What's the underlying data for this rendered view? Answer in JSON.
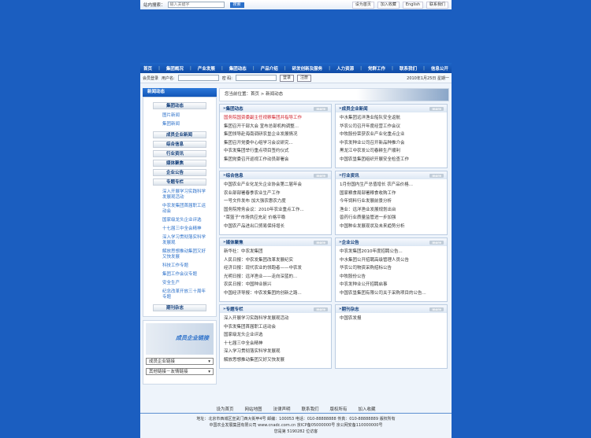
{
  "topbar": {
    "search_label": "站内搜索：",
    "search_placeholder": "输入关键字",
    "search_button": "搜索",
    "links": [
      "设为首页",
      "加入收藏",
      "English",
      "联系我们"
    ]
  },
  "nav": [
    "首页",
    "集团概况",
    "产业发展",
    "集团动态",
    "产品介绍",
    "研发创新及服务",
    "人力资源",
    "党群工作",
    "联系我们",
    "信息公开"
  ],
  "toolbar": {
    "login_label": "会员登录",
    "user_label": "用户名:",
    "pass_label": "密 码:",
    "login_button": "登录",
    "register_button": "注册",
    "date": "2010年1月25日 星期一"
  },
  "sidebar": {
    "title": "新闻动态",
    "items": [
      {
        "label": "集团动态",
        "subs": [
          "图片新闻",
          "集团新闻"
        ]
      },
      {
        "label": "成员企业新闻",
        "subs": []
      },
      {
        "label": "综合信息",
        "subs": []
      },
      {
        "label": "行业资讯",
        "subs": []
      },
      {
        "label": "媒体聚焦",
        "subs": []
      },
      {
        "label": "企业公告",
        "subs": []
      },
      {
        "label": "专题专栏",
        "subs": [
          "深入开展学习实践科学发展观活动",
          "中农发集团首届职工运动会",
          "国家级龙头企业评选",
          "十七届三中全会精神",
          "深入学习贯彻落实科学发展观",
          "解放思想推动集团又好又快发展",
          "科技工作专题",
          "集团工作会议专题",
          "安全生产",
          "纪念改革开放三十周年专题"
        ]
      },
      {
        "label": "期刊杂志",
        "subs": []
      }
    ],
    "banner_text": "成员企业链接",
    "select1": "成员企业链接",
    "select2": "其他链接－友情链接"
  },
  "breadcrumb": "您当前位置：首页 > 新闻动态",
  "panels": [
    {
      "title": "集团动态",
      "more": "more",
      "items": [
        "国务院国资委副主任视察集团并指导工作",
        "集团召开干部大会 宣布总部机构调整...",
        "集团领导赴海南调研农垦企业发展情况",
        "集团召开党委中心组学习会议研究...",
        "中农发集团举行重点项目签约仪式",
        "集团党委召开巡视工作动员部署会"
      ]
    },
    {
      "title": "成员企业新闻",
      "more": "more",
      "items": [
        "中水集团远洋渔业船队安全返航",
        "华农公司召开年度经营工作会议",
        "中牧股份荣获农业产业化重点企业",
        "中农发种业公司召开新品种推介会",
        "黑龙江中农发公司春耕生产顺利",
        "中国农垦集团组织开展安全检查工作"
      ]
    },
    {
      "title": "综合信息",
      "more": "more",
      "items": [
        "中国农业产业化龙头企业协会第二届年会",
        "农业部部署春季农业生产工作",
        "一号文件发布 加大强农惠农力度",
        "国务院常务会议：2010年农业重点工作...",
        "\"菜篮子\"市场供应充足 价格平稳",
        "中国农产品进出口贸易保持增长"
      ]
    },
    {
      "title": "行业资讯",
      "more": "more",
      "items": [
        "1月份国内生产总值增长 农产品价格...",
        "国家粮食局部署粮食收购工作",
        "今年饲料行业发展前景分析",
        "渔业：远洋渔业发展规划出台",
        "兽药行业质量监管进一步加强",
        "中国种业发展现状及未来趋势分析"
      ]
    },
    {
      "title": "媒体聚焦",
      "more": "more",
      "items": [
        "新华社：中农发集团",
        "人民日报：中农发集团改革发展纪实",
        "经济日报：现代农业的领跑者——中农发",
        "光明日报：远洋渔业——走向深蓝的...",
        "农民日报：中国种业振兴",
        "中国经济导报：中农发集团的创新之路..."
      ]
    },
    {
      "title": "企业公告",
      "more": "more",
      "items": [
        "中农发集团2010年度招聘公告...",
        "中水集团公开招聘高级管理人员公告",
        "华农公司物资采购招标公告",
        "中牧股份公告",
        "中农发种业公开招聘启事",
        "中国农垦集团有限公司关于采购项目的公告..."
      ]
    },
    {
      "title": "专题专栏",
      "more": "more",
      "items": [
        "深入开展学习实践科学发展观活动",
        "中农发集团首届职工运动会",
        "国家级龙头企业评选",
        "十七届三中全会精神",
        "深入学习贯彻落实科学发展观",
        "解放思想推动集团又好又快发展"
      ]
    },
    {
      "title": "期刊杂志",
      "more": "more",
      "items": [
        "中国农发报"
      ]
    }
  ],
  "footer": {
    "links": [
      "设为首页",
      "网站地图",
      "法律声明",
      "联系我们",
      "版权所有",
      "加入收藏"
    ],
    "lines": [
      "地址：北京市西城区宣武门西大街甲4号 邮编：100053 电话：010-88888888 传真：010-88888889 版权所有",
      "中国农业发展集团有限公司 www.cnadc.com.cn 京ICP备05000000号 京公网安备110000000号",
      "您是第 5190282 位访客"
    ]
  }
}
